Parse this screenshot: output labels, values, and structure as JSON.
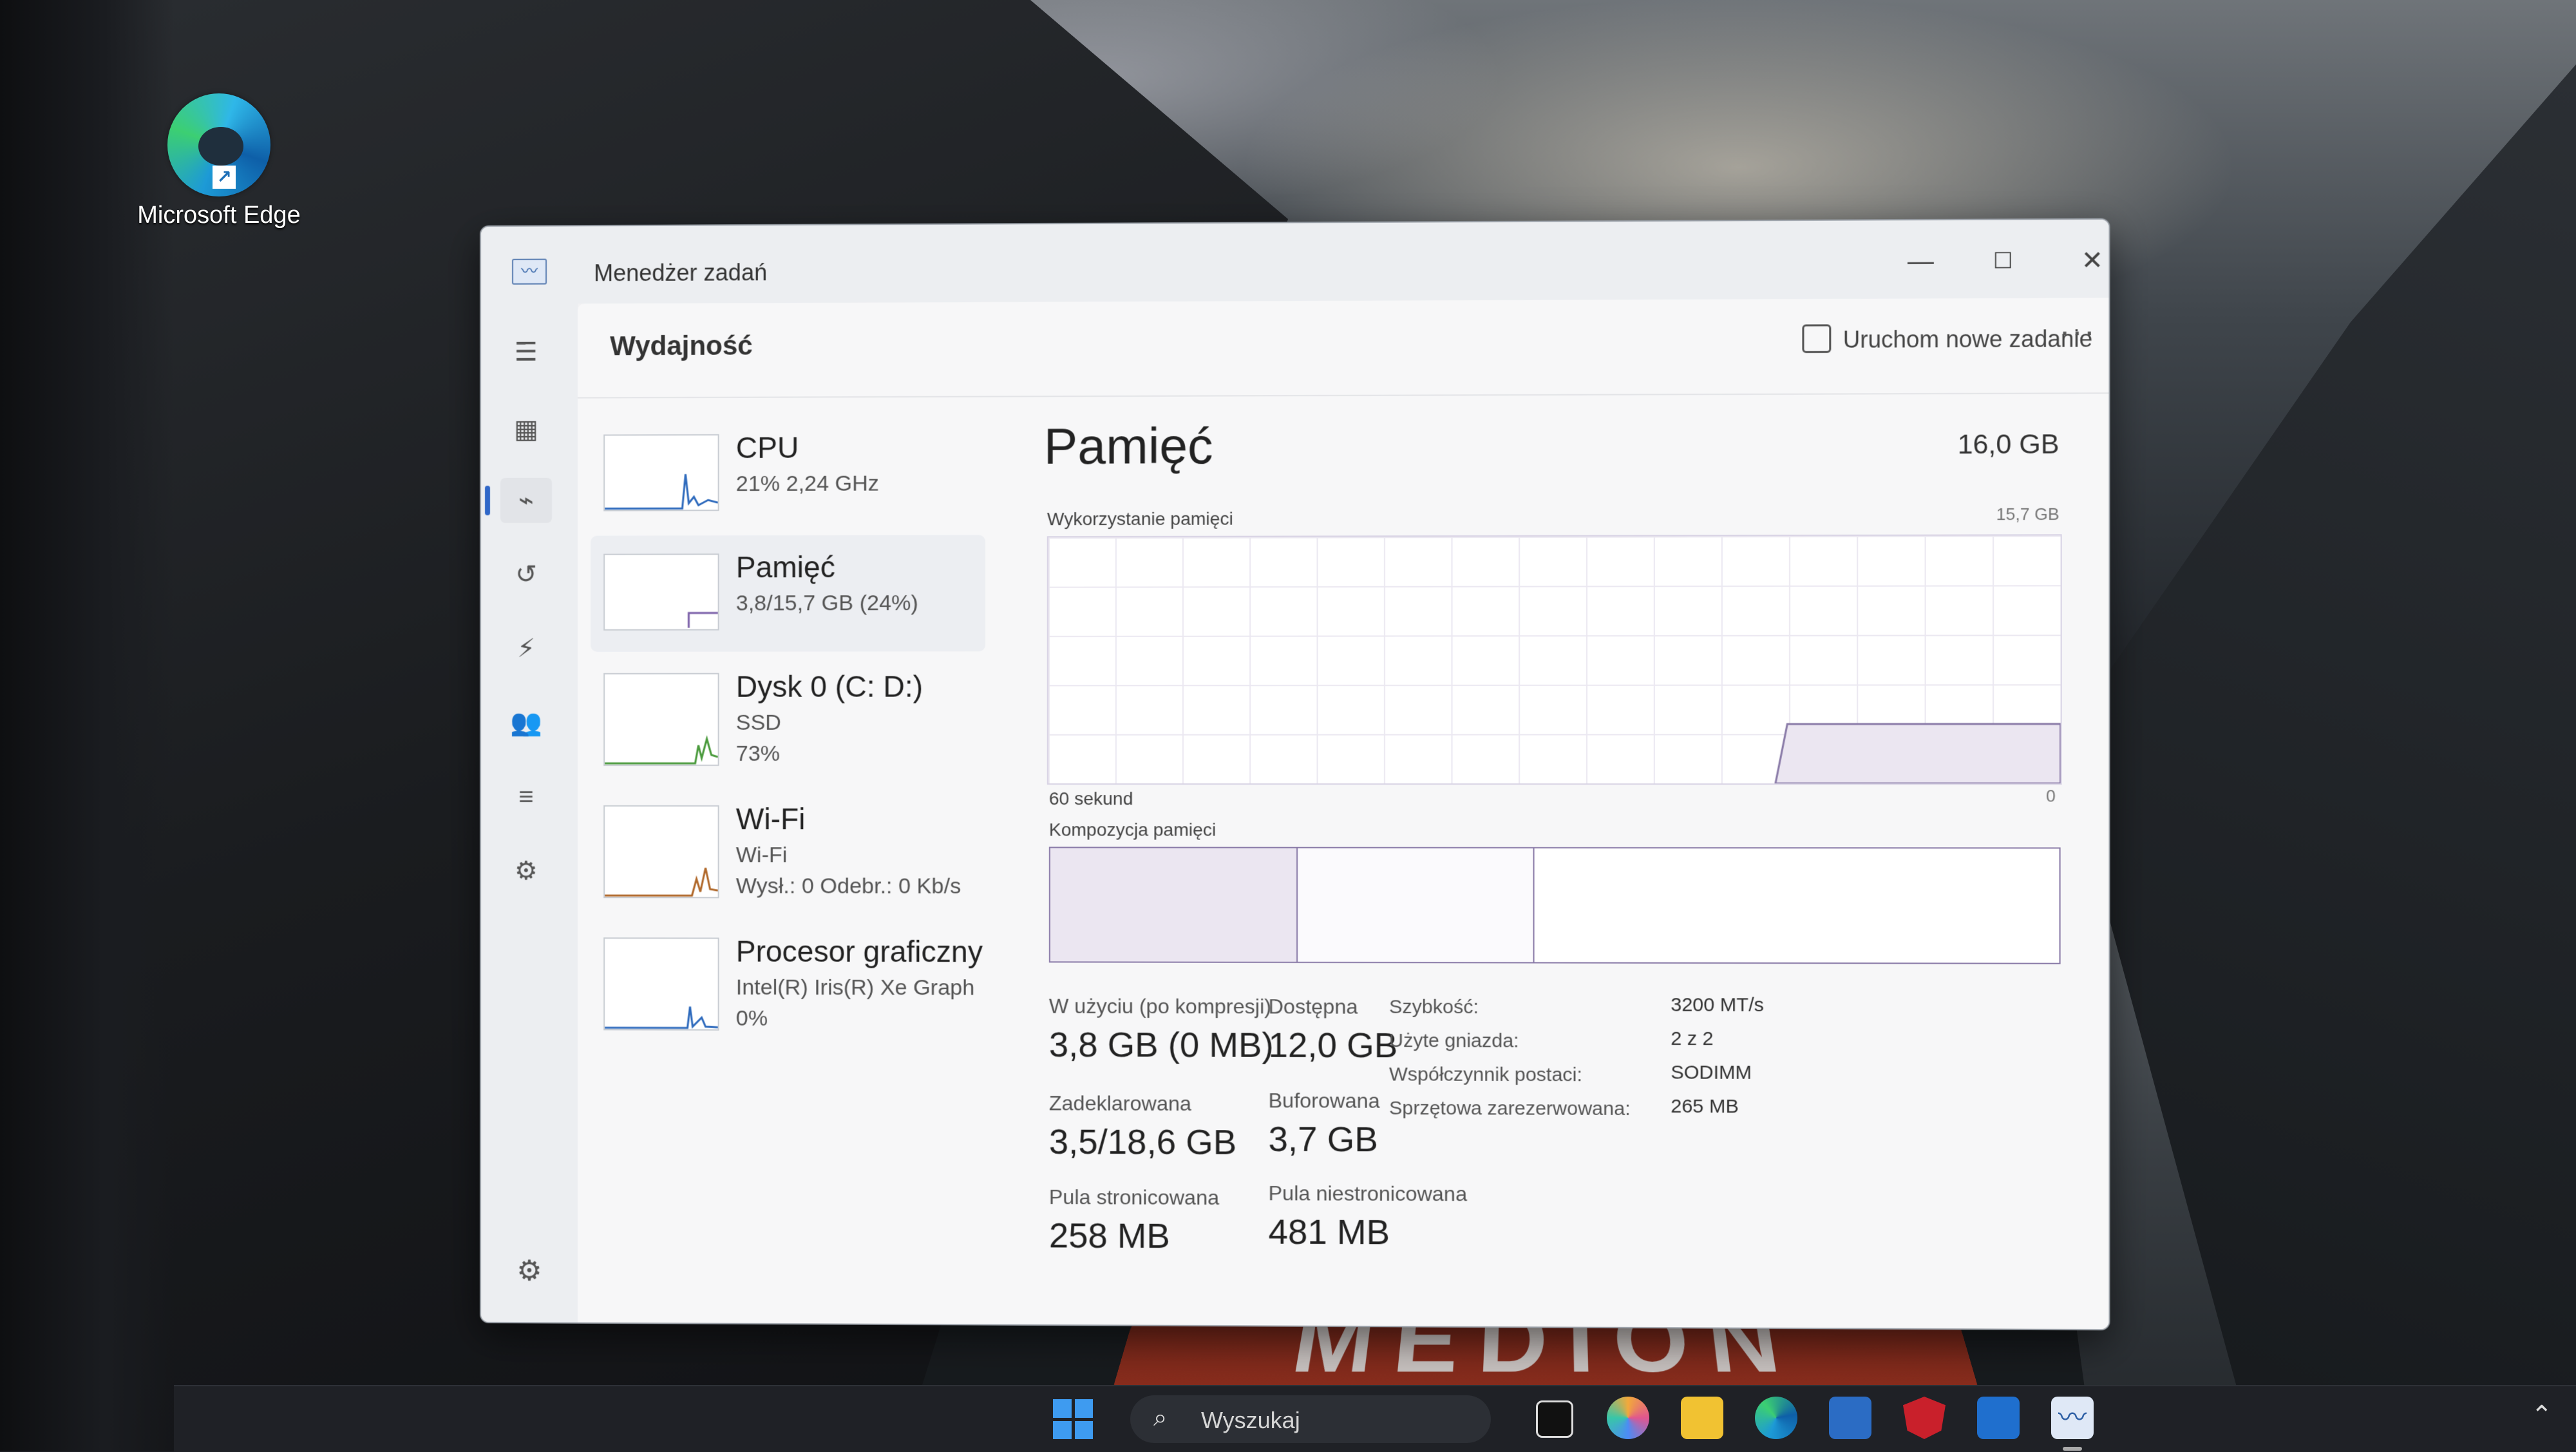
{
  "desktop": {
    "icon_label": "Microsoft Edge",
    "brand_text": "MEDION"
  },
  "window": {
    "title": "Menedżer zadań",
    "icons": {
      "app": "task-manager-icon",
      "minimize": "minimize-icon",
      "maximize": "maximize-icon",
      "close": "close-icon"
    }
  },
  "nav": {
    "items": [
      {
        "name": "menu",
        "icon": "hamburger-icon"
      },
      {
        "name": "processes",
        "icon": "processes-icon"
      },
      {
        "name": "performance",
        "icon": "performance-icon",
        "active": true
      },
      {
        "name": "app-history",
        "icon": "history-icon"
      },
      {
        "name": "startup-apps",
        "icon": "startup-icon"
      },
      {
        "name": "users",
        "icon": "users-icon"
      },
      {
        "name": "details",
        "icon": "details-icon"
      },
      {
        "name": "services",
        "icon": "services-icon"
      }
    ],
    "settings_icon": "gear-icon"
  },
  "header": {
    "title": "Wydajność",
    "new_task_label": "Uruchom nowe zadanie",
    "more_icon": "more-icon"
  },
  "resources": [
    {
      "name": "CPU",
      "sub1": "21% 2,24 GHz",
      "sub2": "",
      "sub3": ""
    },
    {
      "name": "Pamięć",
      "sub1": "3,8/15,7 GB (24%)",
      "sub2": "",
      "sub3": "",
      "selected": true
    },
    {
      "name": "Dysk 0 (C: D:)",
      "sub1": "SSD",
      "sub2": "73%",
      "sub3": ""
    },
    {
      "name": "Wi-Fi",
      "sub1": "Wi-Fi",
      "sub2": "Wysł.: 0 Odebr.: 0 Kb/s",
      "sub3": ""
    },
    {
      "name": "Procesor graficzny",
      "sub1": "Intel(R) Iris(R) Xe Graph",
      "sub2": "0%",
      "sub3": ""
    }
  ],
  "memory": {
    "title": "Pamięć",
    "total": "16,0 GB",
    "usage_label": "Wykorzystanie pamięci",
    "usage_max": "15,7 GB",
    "time_label": "60 sekund",
    "zero_label": "0",
    "composition_label": "Kompozycja pamięci",
    "usage_fraction": 0.24,
    "stats": {
      "in_use_label": "W użyciu (po kompresji)",
      "in_use_value": "3,8 GB (0 MB)",
      "available_label": "Dostępna",
      "available_value": "12,0 GB",
      "committed_label": "Zadeklarowana",
      "committed_value": "3,5/18,6 GB",
      "cached_label": "Buforowana",
      "cached_value": "3,7 GB",
      "paged_label": "Pula stronicowana",
      "paged_value": "258 MB",
      "nonpaged_label": "Pula niestronicowana",
      "nonpaged_value": "481 MB"
    },
    "props": [
      {
        "label": "Szybkość:",
        "value": "3200 MT/s"
      },
      {
        "label": "Użyte gniazda:",
        "value": "2 z 2"
      },
      {
        "label": "Współczynnik postaci:",
        "value": "SODIMM"
      },
      {
        "label": "Sprzętowa zarezerwowana:",
        "value": "265 MB"
      }
    ]
  },
  "taskbar": {
    "search_placeholder": "Wyszukaj",
    "icons": [
      "task-view-icon",
      "copilot-icon",
      "file-explorer-icon",
      "edge-icon",
      "store-icon",
      "mcafee-icon",
      "outlook-icon",
      "task-manager-icon"
    ],
    "tray_icon": "chevron-up-icon"
  }
}
